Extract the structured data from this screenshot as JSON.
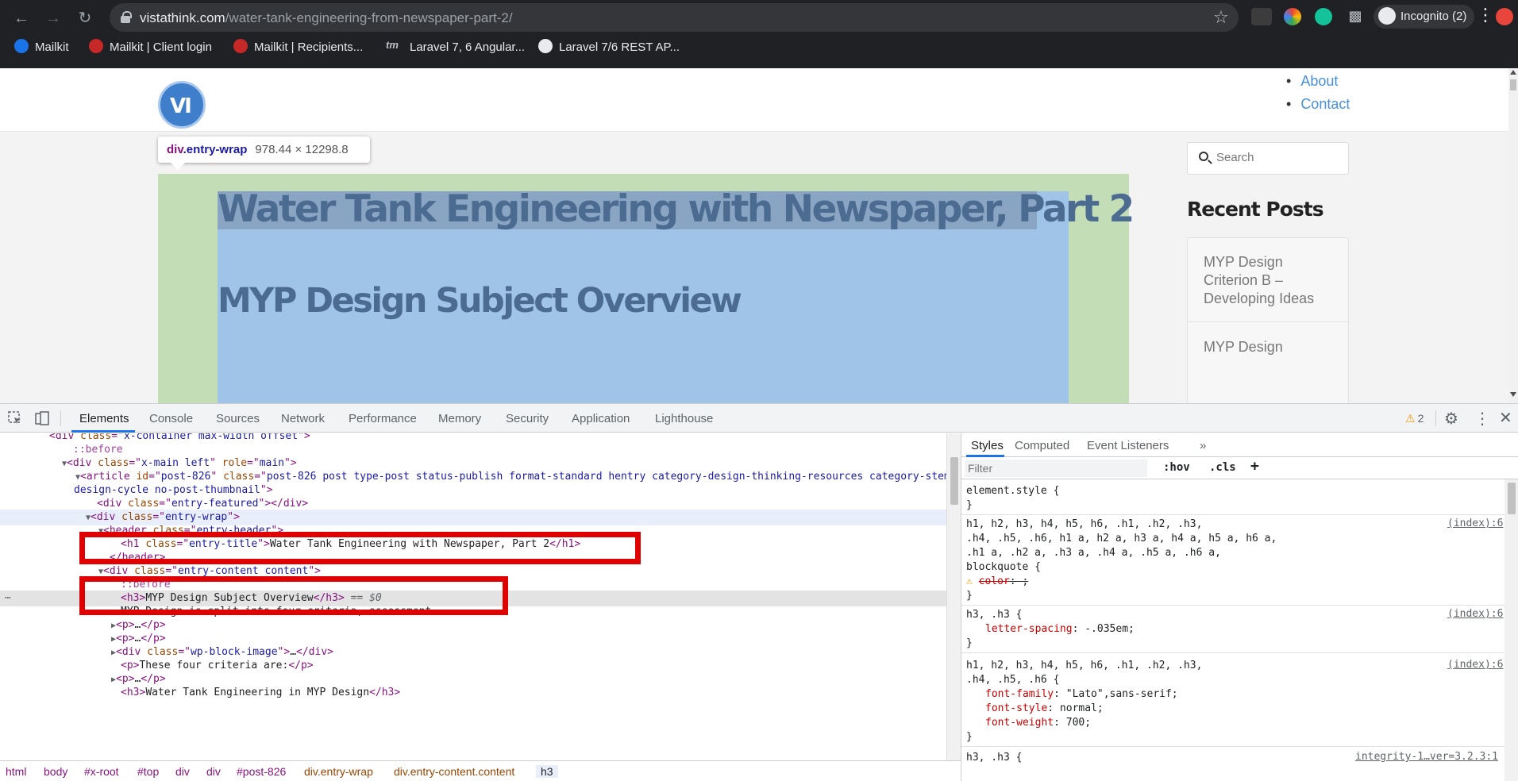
{
  "browser": {
    "url_host": "vistathink.com",
    "url_path": "/water-tank-engineering-from-newspaper-part-2/",
    "profile_label": "Incognito (2)",
    "bookmarks": [
      "Mailkit",
      "Mailkit | Client login",
      "Mailkit | Recipients...",
      "Laravel 7, 6 Angular...",
      "Laravel 7/6 REST AP..."
    ],
    "colors": {
      "chrome_bg": "#202124",
      "omnibox_bg": "#35363a"
    }
  },
  "site": {
    "nav": [
      "About",
      "Contact"
    ],
    "entry_title": "Water Tank Engineering with Newspaper, Part 2",
    "section_heading": "MYP Design Subject Overview",
    "search_placeholder": "Search",
    "recent_posts_title": "Recent Posts",
    "recent_posts": [
      "MYP Design Criterion B – Developing Ideas",
      "MYP Design"
    ],
    "inspect_tooltip": {
      "tag": "div",
      "selector": ".entry-wrap",
      "dimensions": "978.44 × 12298.8"
    },
    "colors": {
      "link": "#4a90d9",
      "heading": "#4c6b91",
      "padding_highlight": "#c3deb6",
      "content_highlight": "#9fc4e7"
    }
  },
  "devtools": {
    "tabs": [
      "Elements",
      "Console",
      "Sources",
      "Network",
      "Performance",
      "Memory",
      "Security",
      "Application",
      "Lighthouse"
    ],
    "warning_count": "2",
    "dom": {
      "l0": {
        "tag": "div",
        "attr": "class",
        "val": "x-container max-width offset"
      },
      "l1": "::before",
      "l2": {
        "tag": "div",
        "attr1": "class",
        "val1": "x-main left",
        "attr2": "role",
        "val2": "main"
      },
      "l3": {
        "tag": "article",
        "attr1": "id",
        "val1": "post-826",
        "attr2": "class",
        "val2": "post-826 post type-post status-publish format-standard hentry category-design-thinking-resources category-stem-lesson-ideas tag-myp-",
        "val2_wrap": "design-cycle no-post-thumbnail"
      },
      "l4": {
        "tag": "div",
        "attr": "class",
        "val": "entry-featured"
      },
      "l5": {
        "tag": "div",
        "attr": "class",
        "val": "entry-wrap"
      },
      "l6": {
        "tag": "header",
        "attr": "class",
        "val": "entry-header"
      },
      "l7": {
        "tag": "h1",
        "attr": "class",
        "val": "entry-title",
        "text": "Water Tank Engineering with Newspaper, Part 2"
      },
      "l8": "</header>",
      "l9": {
        "tag": "div",
        "attr": "class",
        "val": "entry-content content"
      },
      "l10": "::before",
      "l11": {
        "tag": "h3",
        "text": "MYP Design Subject Overview",
        "eq": "== $0"
      },
      "l12": "MYP Design is split into four criteria, assessment",
      "l13": "p",
      "l14": "p",
      "l15": {
        "tag": "div",
        "attr": "class",
        "val": "wp-block-image"
      },
      "l16": {
        "tag": "p",
        "text": "These four criteria are:"
      },
      "l17": "p",
      "l18": {
        "tag": "h3",
        "text": "Water Tank Engineering in MYP Design"
      }
    },
    "breadcrumbs": [
      "html",
      "body",
      "#x-root",
      "#top",
      "div",
      "div",
      "#post-826",
      "div.entry-wrap",
      "div.entry-content.content",
      "h3"
    ],
    "styles": {
      "tabs": [
        "Styles",
        "Computed",
        "Event Listeners",
        "»"
      ],
      "filter_placeholder": "Filter",
      "hov": ":hov",
      "cls": ".cls",
      "plus": "+",
      "rule0_selector": "element.style {",
      "close_brace": "}",
      "rule1_selector_a": "h1, h2, h3, h4, h5, h6, .h1, .h2, .h3,",
      "rule1_selector_b": ".h4, .h5, .h6, h1 a, h2 a, h3 a, h4 a, h5 a, h6 a,",
      "rule1_selector_c": ".h1 a, .h2 a, .h3 a, .h4 a, .h5 a, .h6 a,",
      "rule1_selector_d": "blockquote {",
      "rule1_prop": "color",
      "rule1_val": ": ;",
      "src_index": "(index):6",
      "rule2_selector": "h3, .h3 {",
      "rule2_prop": "letter-spacing",
      "rule2_val": ": -.035em;",
      "rule3_selector_a": "h1, h2, h3, h4, h5, h6, .h1, .h2, .h3,",
      "rule3_selector_b": ".h4, .h5, .h6 {",
      "rule3_p1": "font-family",
      "rule3_v1": ": \"Lato\",sans-serif;",
      "rule3_p2": "font-style",
      "rule3_v2": ": normal;",
      "rule3_p3": "font-weight",
      "rule3_v3": ": 700;",
      "rule4_selector": "h3, .h3 {",
      "rule4_src": "integrity-1…ver=3.2.3:1"
    }
  }
}
